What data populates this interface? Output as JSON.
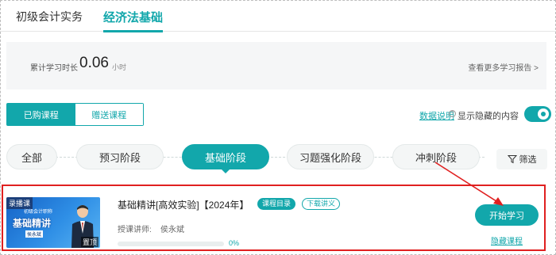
{
  "subject_tabs": [
    {
      "label": "初级会计实务",
      "active": false
    },
    {
      "label": "经济法基础",
      "active": true
    }
  ],
  "study_stats": {
    "label": "累计学习时长",
    "value": "0.06",
    "unit": "小时",
    "more_link": "查看更多学习报告 >"
  },
  "course_toggle": {
    "purchased": "已购课程",
    "gifted": "赠送课程"
  },
  "data_description": "数据说明",
  "show_hidden": {
    "label": "显示隐藏的内容",
    "enabled": true
  },
  "stages": [
    {
      "label": "全部",
      "active": false
    },
    {
      "label": "预习阶段",
      "active": false
    },
    {
      "label": "基础阶段",
      "active": true
    },
    {
      "label": "习题强化阶段",
      "active": false
    },
    {
      "label": "冲刺阶段",
      "active": false
    }
  ],
  "filter": {
    "label": "筛选",
    "icon": "filter-icon"
  },
  "course": {
    "thumbnail": {
      "tag": "录播课",
      "subtitle": "初级会计职称",
      "title": "基础精讲",
      "teacher_tag": "侯永斌",
      "pin_label": "置顶"
    },
    "title": "基础精讲[高效实验]【2024年】",
    "catalog_badge": "课程目录",
    "handout_badge": "下载讲义",
    "teacher_label": "授课讲师:",
    "teacher_name": "侯永斌",
    "progress": 0,
    "progress_text": "0%",
    "start_button": "开始学习",
    "hide_link": "隐藏课程"
  },
  "colors": {
    "accent": "#12a7ab",
    "highlight_box": "#e02020",
    "panel_bg": "#f5f6f7"
  }
}
